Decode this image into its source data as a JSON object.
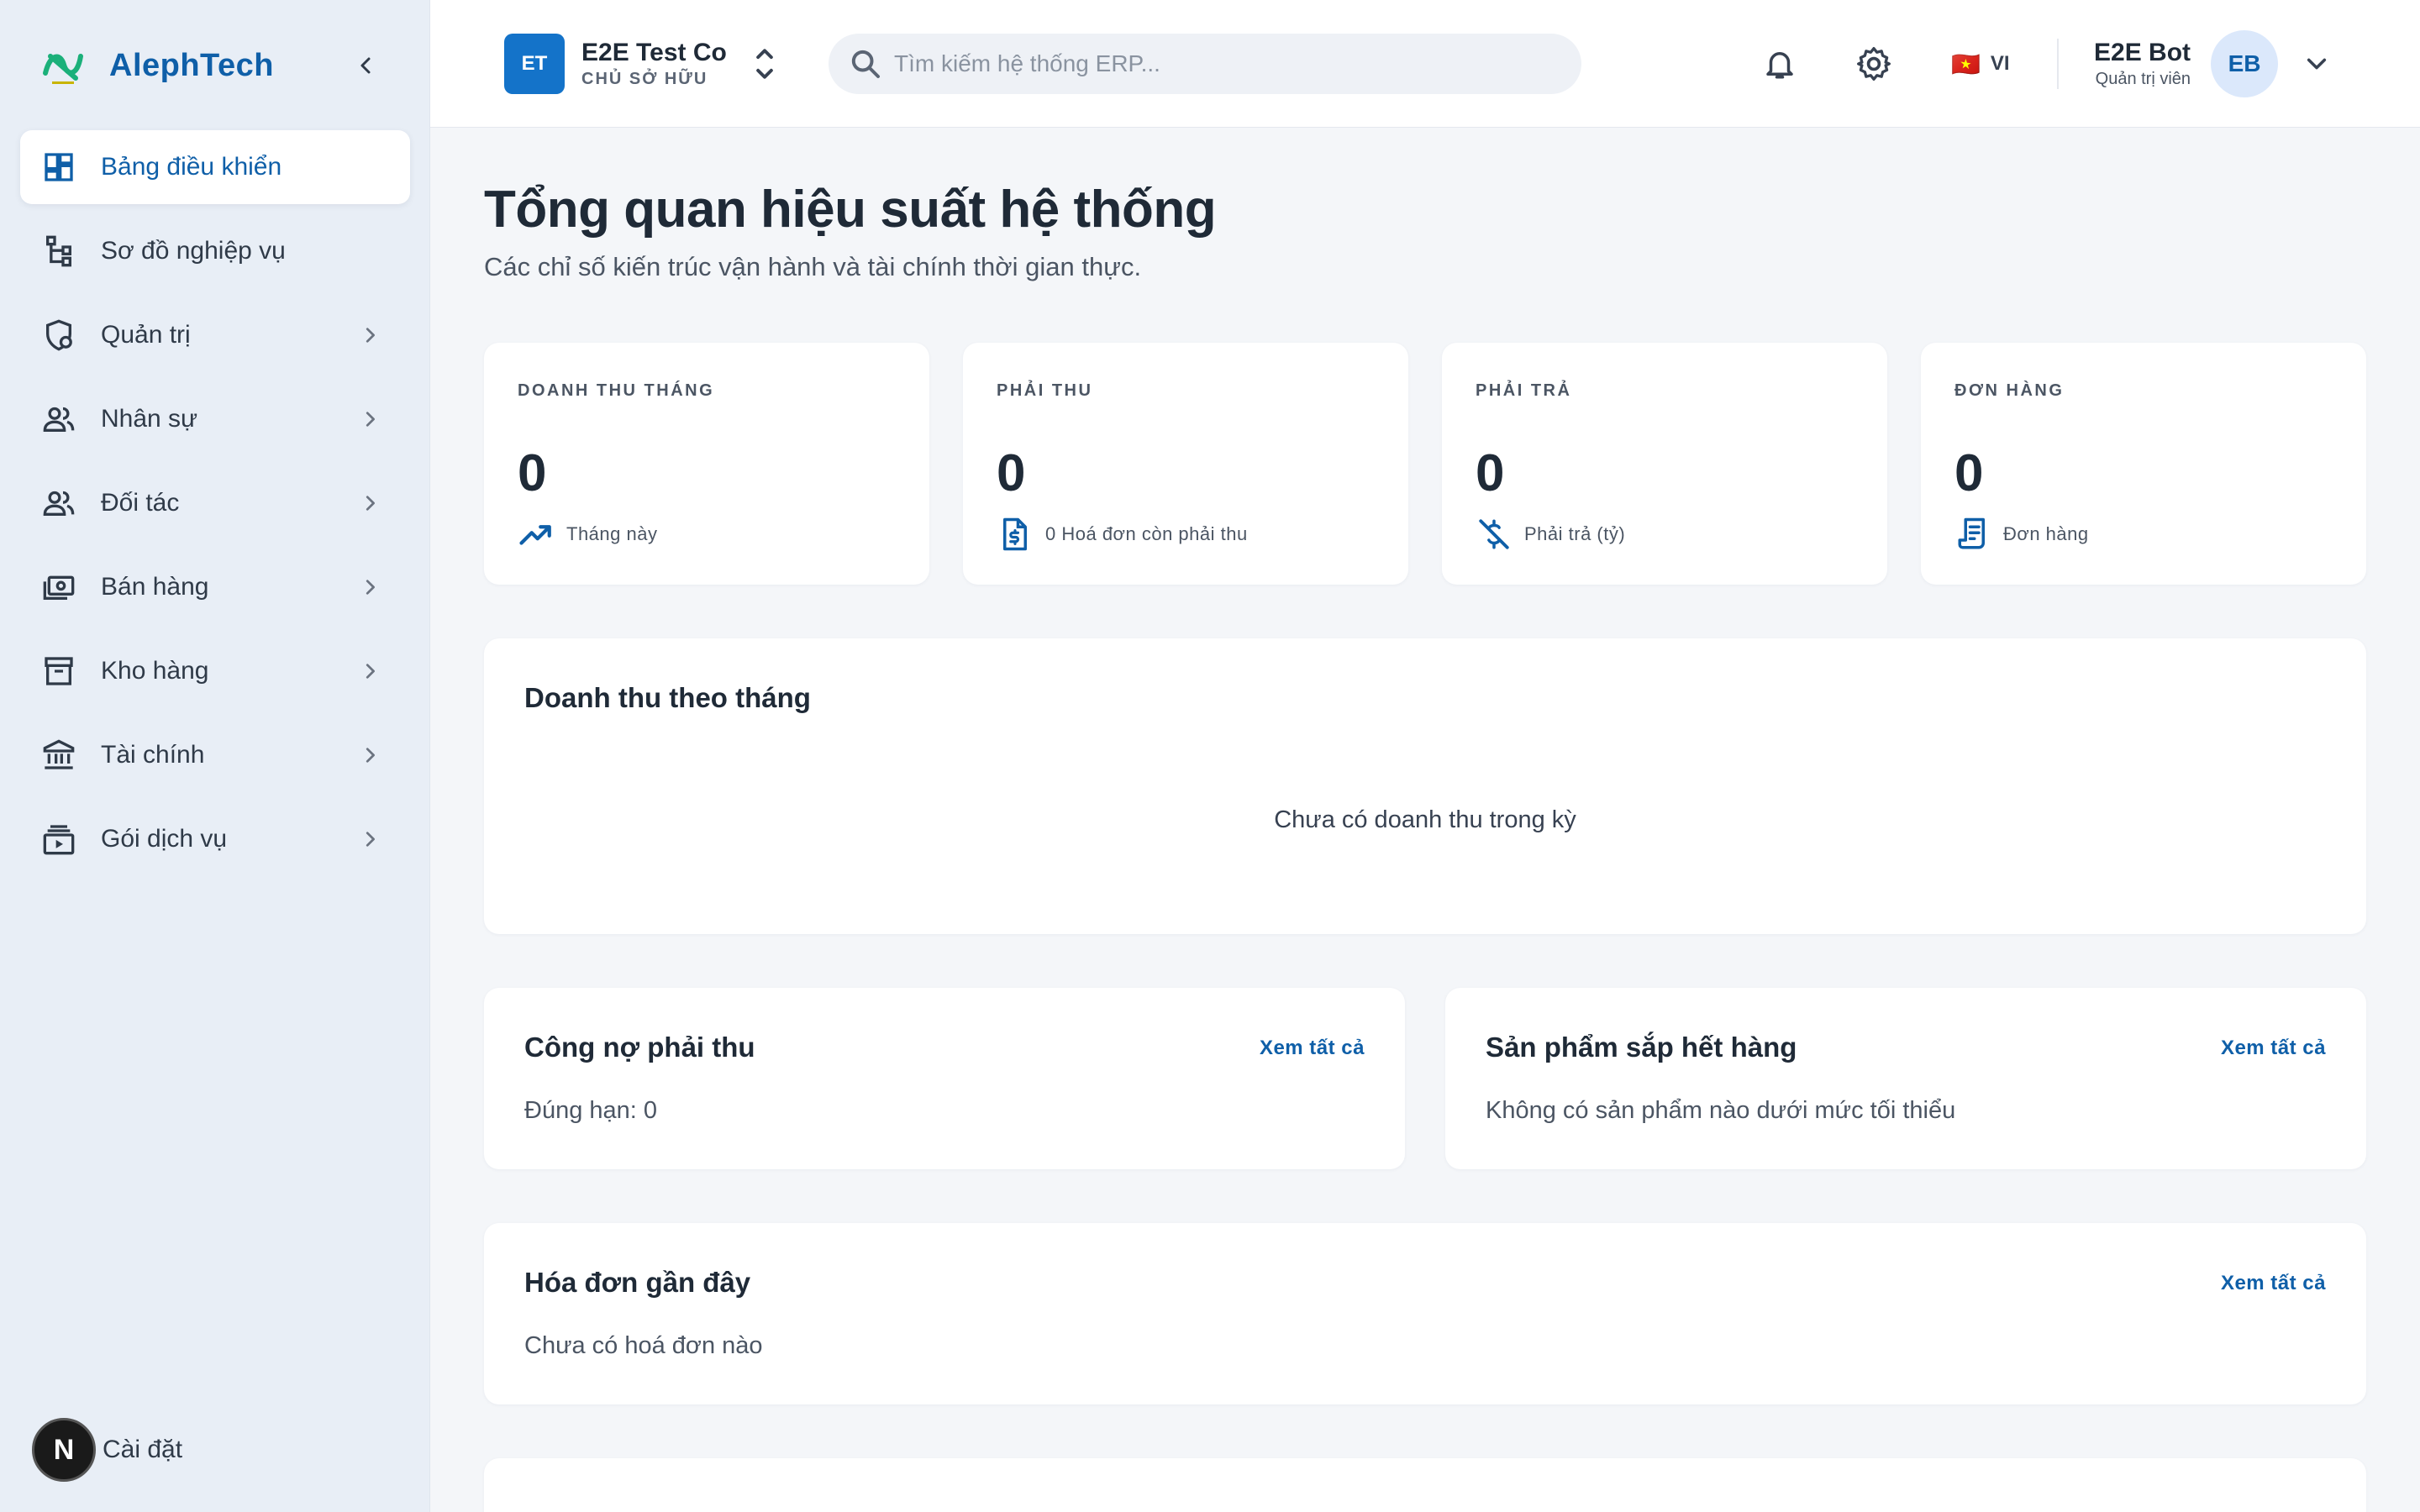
{
  "brand": {
    "name": "AlephTech"
  },
  "sidebar": {
    "items": [
      {
        "key": "dashboard",
        "label": "Bảng điều khiển",
        "active": true,
        "has_children": false
      },
      {
        "key": "diagram",
        "label": "Sơ đồ nghiệp vụ",
        "active": false,
        "has_children": false
      },
      {
        "key": "admin",
        "label": "Quản trị",
        "active": false,
        "has_children": true
      },
      {
        "key": "hr",
        "label": "Nhân sự",
        "active": false,
        "has_children": true
      },
      {
        "key": "partners",
        "label": "Đối tác",
        "active": false,
        "has_children": true
      },
      {
        "key": "sales",
        "label": "Bán hàng",
        "active": false,
        "has_children": true
      },
      {
        "key": "warehouse",
        "label": "Kho hàng",
        "active": false,
        "has_children": true
      },
      {
        "key": "finance",
        "label": "Tài chính",
        "active": false,
        "has_children": true
      },
      {
        "key": "plans",
        "label": "Gói dịch vụ",
        "active": false,
        "has_children": true
      }
    ],
    "footer": {
      "badge": "N",
      "label": "Cài đặt"
    }
  },
  "header": {
    "org": {
      "avatar": "ET",
      "name": "E2E Test Co",
      "role": "CHỦ SỞ HỮU"
    },
    "search": {
      "placeholder": "Tìm kiếm hệ thống ERP..."
    },
    "lang": {
      "flag": "🇻🇳",
      "code": "VI"
    },
    "user": {
      "name": "E2E Bot",
      "role": "Quản trị viên",
      "avatar": "EB"
    }
  },
  "page": {
    "title": "Tổng quan hiệu suất hệ thống",
    "subtitle": "Các chỉ số kiến trúc vận hành và tài chính thời gian thực."
  },
  "stats": [
    {
      "label": "Doanh thu tháng",
      "value": "0",
      "foot": "Tháng này",
      "icon": "trending-up-icon"
    },
    {
      "label": "Phải thu",
      "value": "0",
      "foot": "0 Hoá đơn còn phải thu",
      "icon": "invoice-dollar-icon"
    },
    {
      "label": "Phải trả",
      "value": "0",
      "foot": "Phải trả (tỷ)",
      "icon": "money-off-icon"
    },
    {
      "label": "Đơn hàng",
      "value": "0",
      "foot": "Đơn hàng",
      "icon": "receipt-icon"
    }
  ],
  "revenue_card": {
    "title": "Doanh thu theo tháng",
    "empty": "Chưa có doanh thu trong kỳ"
  },
  "receivables_card": {
    "title": "Công nợ phải thu",
    "link": "Xem tất cả",
    "body": "Đúng hạn: 0"
  },
  "low_stock_card": {
    "title": "Sản phẩm sắp hết hàng",
    "link": "Xem tất cả",
    "body": "Không có sản phẩm nào dưới mức tối thiểu"
  },
  "invoices_card": {
    "title": "Hóa đơn gần đây",
    "link": "Xem tất cả",
    "body": "Chưa có hoá đơn nào"
  },
  "colors": {
    "brand": "#0f5fa8",
    "sidebar_bg": "#e8eef6",
    "page_bg": "#f4f6f9"
  }
}
